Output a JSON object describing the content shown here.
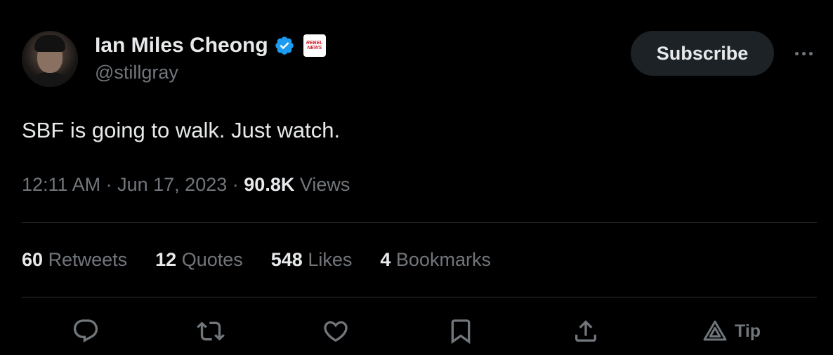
{
  "author": {
    "display_name": "Ian Miles Cheong",
    "handle": "@stillgray",
    "verified": true,
    "affiliate_badge_text": "REBEL NEWS"
  },
  "header": {
    "subscribe_label": "Subscribe"
  },
  "tweet": {
    "text": "SBF is going to walk. Just watch.",
    "time": "12:11 AM",
    "date": "Jun 17, 2023",
    "views_count": "90.8K",
    "views_label": "Views",
    "separator": "·"
  },
  "stats": {
    "retweets": {
      "count": "60",
      "label": "Retweets"
    },
    "quotes": {
      "count": "12",
      "label": "Quotes"
    },
    "likes": {
      "count": "548",
      "label": "Likes"
    },
    "bookmarks": {
      "count": "4",
      "label": "Bookmarks"
    }
  },
  "actions": {
    "icons": [
      "reply-icon",
      "retweet-icon",
      "like-icon",
      "bookmark-icon",
      "share-icon",
      "tip-icon",
      "more-icon",
      "verified-badge-icon"
    ],
    "tip_label": "Tip"
  },
  "colors": {
    "background": "#000000",
    "primary_text": "#e7e9ea",
    "secondary_text": "#71767b",
    "verified_blue": "#1d9bf0",
    "divider": "#2f3336",
    "subscribe_bg": "#1c2226"
  }
}
